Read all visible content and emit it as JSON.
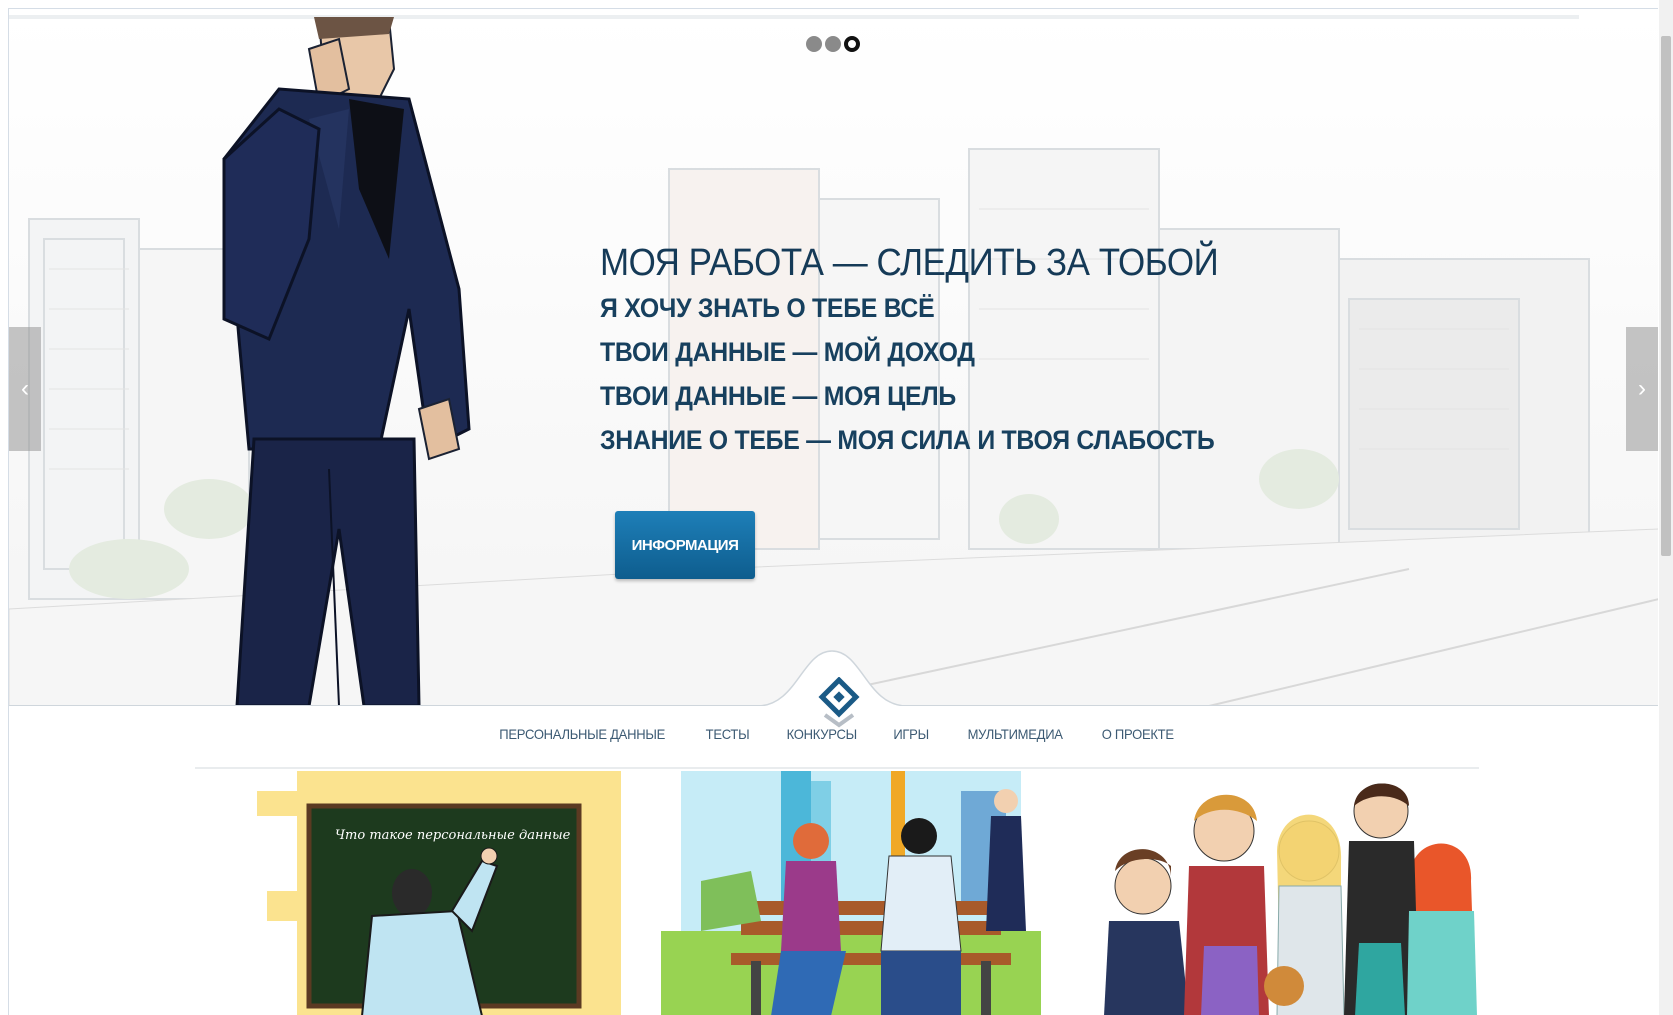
{
  "slider": {
    "dots": [
      {
        "active": false
      },
      {
        "active": false
      },
      {
        "active": true
      }
    ],
    "title": "МОЯ РАБОТА — СЛЕДИТЬ ЗА ТОБОЙ",
    "lines": [
      "Я ХОЧУ ЗНАТЬ О ТЕБЕ ВСЁ",
      "ТВОИ ДАННЫЕ — МОЙ ДОХОД",
      "ТВОИ ДАННЫЕ — МОЯ ЦЕЛЬ",
      "ЗНАНИЕ О ТЕБЕ — МОЯ СИЛА И ТВОЯ СЛАБОСТЬ"
    ],
    "button_label": "ИНФОРМАЦИЯ",
    "prev_icon": "chevron-left-icon",
    "next_icon": "chevron-right-icon",
    "prev_glyph": "‹",
    "next_glyph": "›"
  },
  "nav": {
    "items": [
      {
        "label": "ПЕРСОНАЛЬНЫЕ ДАННЫЕ"
      },
      {
        "label": "ТЕСТЫ"
      },
      {
        "label": "КОНКУРСЫ"
      },
      {
        "label": "ИГРЫ"
      },
      {
        "label": "МУЛЬТИМЕДИА"
      },
      {
        "label": "О ПРОЕКТЕ"
      }
    ]
  },
  "cards": {
    "chalkboard_text": "Что такое персональные данные",
    "items": [
      {
        "name": "chalkboard-teacher-illustration"
      },
      {
        "name": "park-bench-people-illustration"
      },
      {
        "name": "group-of-teens-illustration"
      }
    ]
  },
  "colors": {
    "accent": "#17405e",
    "button": "#1a73a8",
    "nav_text": "#3c5a73"
  }
}
